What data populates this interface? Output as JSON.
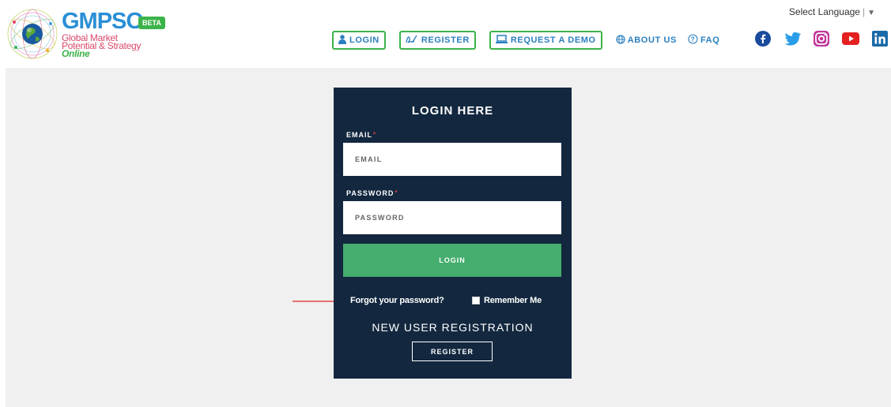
{
  "logo": {
    "brand": "GMPSO",
    "badge": "BETA",
    "tagline_line1": "Global Market",
    "tagline_line2": "Potential & Strategy",
    "tagline_line3": "Online"
  },
  "language": {
    "label": "Select Language",
    "separator": "|",
    "arrow": "▼"
  },
  "nav": {
    "login": "LOGIN",
    "register": "REGISTER",
    "request_demo": "REQUEST A DEMO",
    "about": "ABOUT US",
    "faq": "FAQ"
  },
  "social": {
    "icons": [
      "facebook-icon",
      "twitter-icon",
      "instagram-icon",
      "youtube-icon",
      "linkedin-icon"
    ]
  },
  "login_form": {
    "title": "LOGIN HERE",
    "email_label": "EMAIL",
    "email_placeholder": "EMAIL",
    "password_label": "PASSWORD",
    "password_placeholder": "PASSWORD",
    "required_mark": "*",
    "login_button": "LOGIN",
    "forgot": "Forgot your password?",
    "remember": "Remember Me",
    "new_user": "NEW USER REGISTRATION",
    "register_button": "REGISTER"
  },
  "colors": {
    "panel_bg": "#13283f",
    "login_green": "#45ad6e",
    "nav_border_green": "#3cb34a",
    "nav_text_blue": "#2a7fc0",
    "annotation_arrow": "#e02020"
  }
}
